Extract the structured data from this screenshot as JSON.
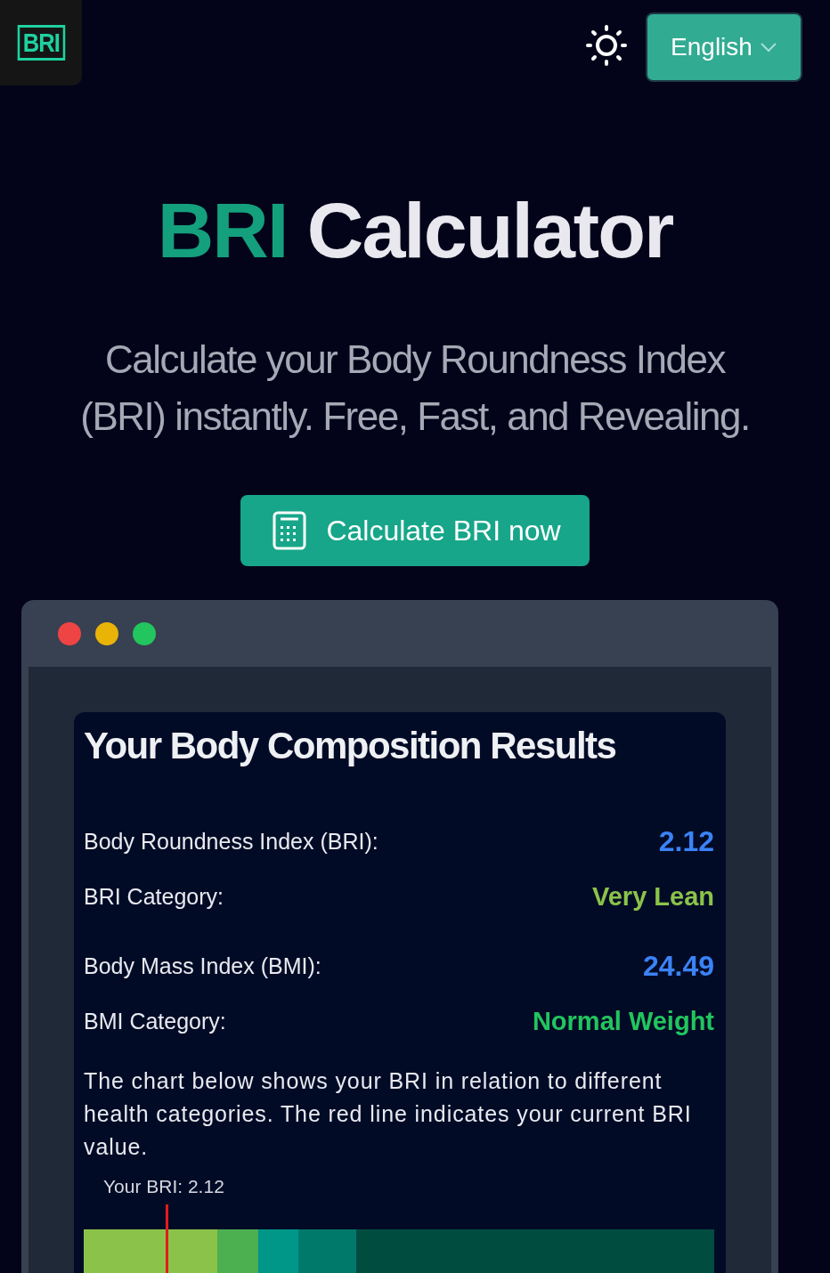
{
  "header": {
    "logo": "BRI",
    "language": "English"
  },
  "hero": {
    "title_accent": "BRI",
    "title_rest": "Calculator",
    "subtitle": "Calculate your Body Roundness Index (BRI) instantly. Free, Fast, and Revealing.",
    "cta": "Calculate BRI now"
  },
  "window": {
    "dots": [
      {
        "color": "#ef4444"
      },
      {
        "color": "#eab308"
      },
      {
        "color": "#22c55e"
      }
    ]
  },
  "results": {
    "title": "Your Body Composition Results",
    "rows": [
      {
        "label": "Body Roundness Index (BRI):",
        "value": "2.12",
        "color": "#3b82f6",
        "kind": "number"
      },
      {
        "label": "BRI Category:",
        "value": "Very Lean",
        "color": "#8bc34a",
        "kind": "category"
      },
      {
        "label": "Body Mass Index (BMI):",
        "value": "24.49",
        "color": "#3b82f6",
        "kind": "number"
      },
      {
        "label": "BMI Category:",
        "value": "Normal Weight",
        "color": "#22c55e",
        "kind": "category"
      }
    ],
    "note": "The chart below shows your BRI in relation to different health categories. The red line indicates your current BRI value.",
    "marker_label": "Your BRI: 2.12"
  }
}
